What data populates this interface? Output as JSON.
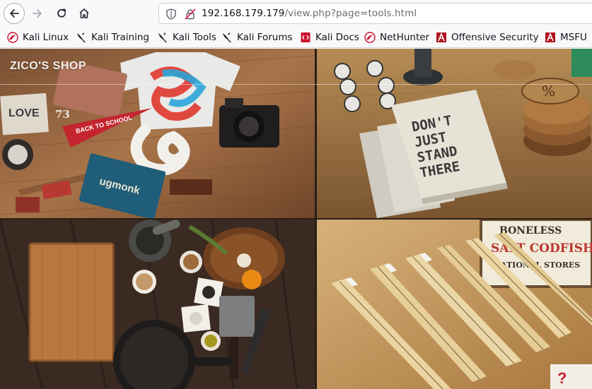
{
  "browser": {
    "url_host": "192.168.179.179",
    "url_path": "/view.php?page=tools.html"
  },
  "bookmarks": [
    {
      "label": "Kali Linux",
      "icon": "kali-dragon-icon"
    },
    {
      "label": "Kali Training",
      "icon": "kali-dragon-icon"
    },
    {
      "label": "Kali Tools",
      "icon": "kali-dragon-icon"
    },
    {
      "label": "Kali Forums",
      "icon": "kali-dragon-icon"
    },
    {
      "label": "Kali Docs",
      "icon": "kali-docs-icon"
    },
    {
      "label": "NetHunter",
      "icon": "nethunter-icon"
    },
    {
      "label": "Offensive Security",
      "icon": "offsec-icon"
    },
    {
      "label": "MSFU",
      "icon": "offsec-icon"
    }
  ],
  "site": {
    "brand": "ZICO'S SHOP"
  },
  "photos": {
    "t1": {
      "pennant": "BACK TO SCHOOL",
      "notebook_left": "LOVE",
      "book": "ugmonk",
      "numbers": "73"
    },
    "t2": {
      "book_text_1": "DON'T",
      "book_text_2": "JUST",
      "book_text_3": "STAND",
      "book_text_4": "THERE"
    },
    "t4": {
      "sign_1": "BONELESS",
      "sign_2": "SALT CODFISH",
      "sign_3": "NATIONAL STORES"
    }
  },
  "colors": {
    "kali_red": "#c8102e",
    "offsec_red": "#b0151f"
  }
}
